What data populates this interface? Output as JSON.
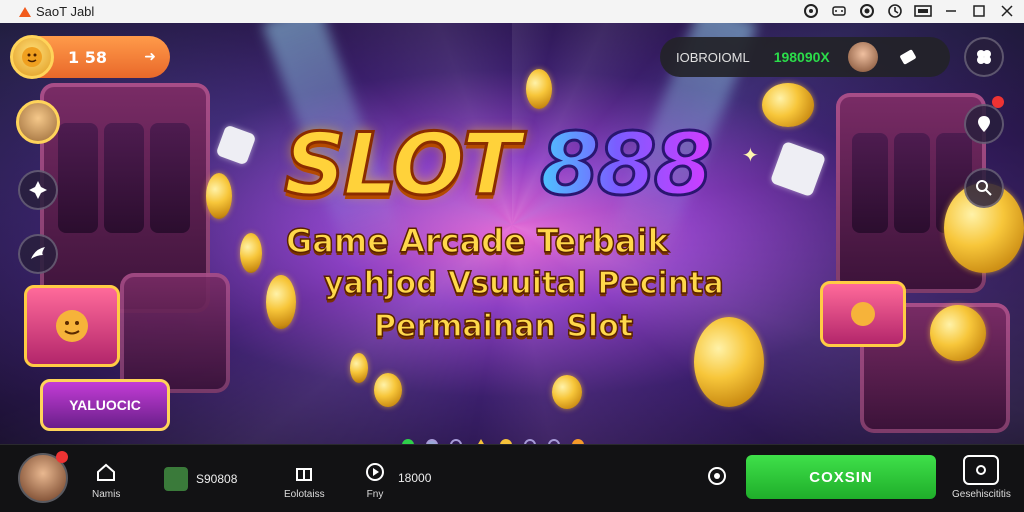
{
  "window": {
    "title": "SaoT Jabl"
  },
  "banner": {
    "logo_slot": "SLOT",
    "logo_number": "888",
    "tagline_1": "Game Arcade Terbaik",
    "tagline_2": "yahjod Vsuuital Pecinta",
    "tagline_3": "Permainan Slot",
    "left_sign": "YALUOCIC",
    "carousel_dots": 8,
    "carousel_active": 0
  },
  "profile": {
    "level": "1 58"
  },
  "balance": {
    "account": "IOBROIOML",
    "amount": "198090X"
  },
  "bottom": {
    "nav_home": "Namis",
    "stat_1": "S90808",
    "nav_rewards": "Eolotaiss",
    "nav_play": "Fny",
    "stat_2": "18000",
    "cta": "COXSIN",
    "nav_camera": "Gesehiscititis"
  },
  "colors": {
    "cta": "#2ec83a",
    "balance_amount": "#2bdc4a",
    "title_gold": "#ffd23a"
  }
}
